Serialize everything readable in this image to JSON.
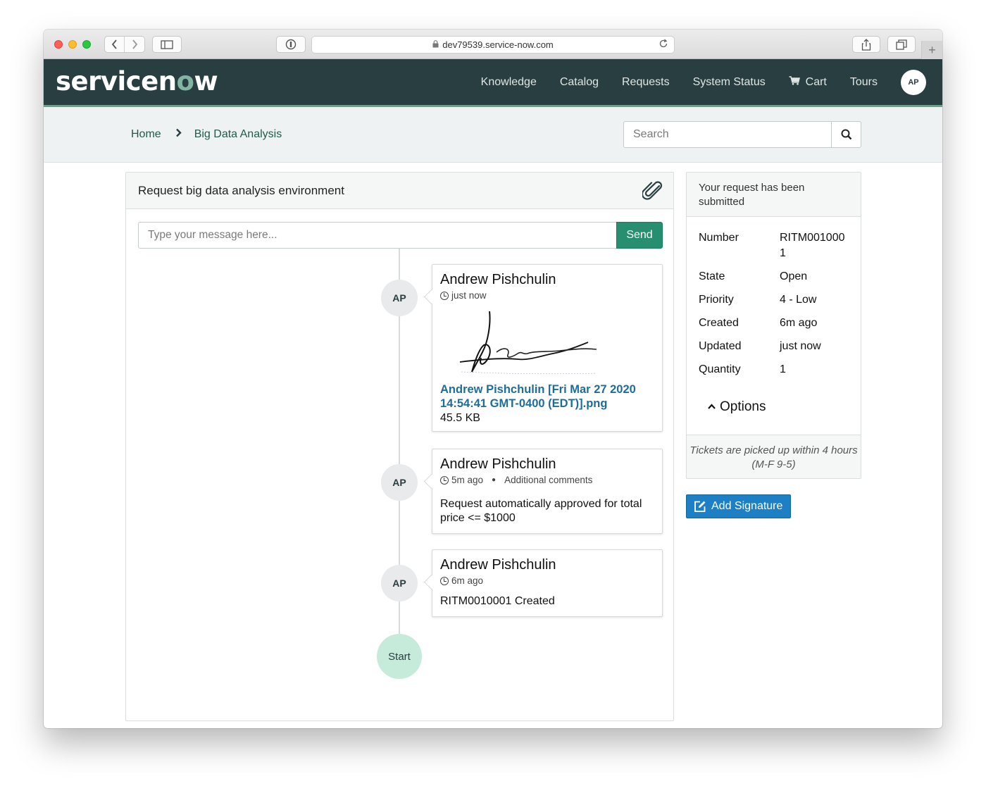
{
  "browser": {
    "url": "dev79539.service-now.com"
  },
  "header": {
    "logo_text_a": "servicen",
    "logo_text_o": "o",
    "logo_text_b": "w",
    "nav": {
      "knowledge": "Knowledge",
      "catalog": "Catalog",
      "requests": "Requests",
      "system_status": "System Status",
      "cart": "Cart",
      "tours": "Tours"
    },
    "avatar_initials": "AP"
  },
  "breadcrumb": {
    "home": "Home",
    "current": "Big Data Analysis"
  },
  "search": {
    "placeholder": "Search"
  },
  "main": {
    "title": "Request big data analysis environment",
    "message_placeholder": "Type your message here...",
    "send_label": "Send",
    "entries": [
      {
        "avatar": "AP",
        "author": "Andrew Pishchulin",
        "time": "just now",
        "attachment_name": "Andrew Pishchulin [Fri Mar 27 2020 14:54:41 GMT-0400 (EDT)].png",
        "attachment_size": "45.5 KB"
      },
      {
        "avatar": "AP",
        "author": "Andrew Pishchulin",
        "time": "5m ago",
        "type": "Additional comments",
        "text": "Request automatically approved for total price <= $1000"
      },
      {
        "avatar": "AP",
        "author": "Andrew Pishchulin",
        "time": "6m ago",
        "text": "RITM0010001 Created"
      }
    ],
    "start_label": "Start"
  },
  "side": {
    "heading": "Your request has been submitted",
    "fields": [
      {
        "label": "Number",
        "value": "RITM0010001"
      },
      {
        "label": "State",
        "value": "Open"
      },
      {
        "label": "Priority",
        "value": "4 - Low"
      },
      {
        "label": "Created",
        "value": "6m ago"
      },
      {
        "label": "Updated",
        "value": "just now"
      },
      {
        "label": "Quantity",
        "value": "1"
      }
    ],
    "options_label": "Options",
    "footer": "Tickets are picked up within 4 hours (M-F 9-5)"
  },
  "add_signature_label": "Add Signature",
  "colors": {
    "header_bg": "#293e40",
    "header_accent": "#62a583",
    "send_btn": "#278e6f",
    "link": "#1d6d9a",
    "add_signature_btn": "#1d7fc4",
    "start_bubble": "#c7ebdb"
  }
}
